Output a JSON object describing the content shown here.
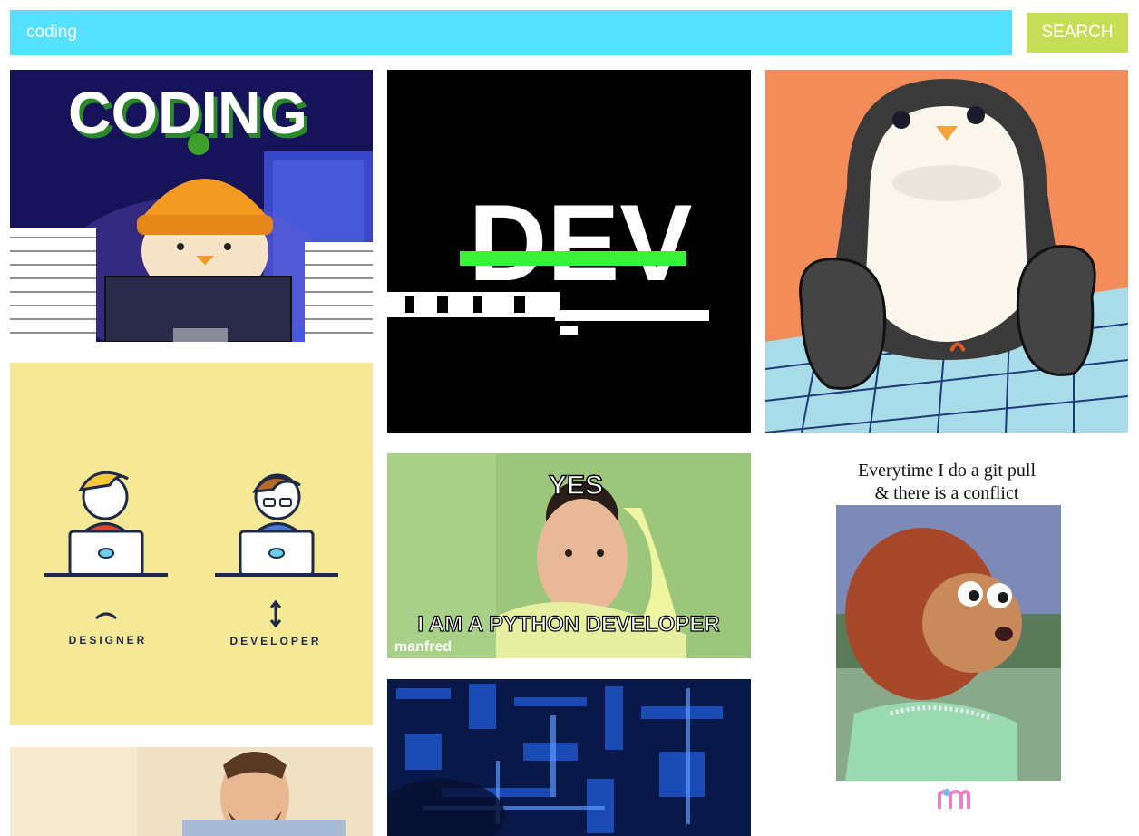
{
  "search": {
    "value": "coding",
    "button_label": "SEARCH"
  },
  "colors": {
    "search_bg": "#54e0ff",
    "button_bg": "#c6dd58"
  },
  "gifs": [
    {
      "name": "coding-penguin-gif",
      "text": "CODING"
    },
    {
      "name": "dev-glitch-gif",
      "text": "DEV"
    },
    {
      "name": "penguin-crossword-gif",
      "text": ""
    },
    {
      "name": "designer-developer-gif",
      "labels": [
        "DESIGNER",
        "DEVELOPER"
      ]
    },
    {
      "name": "python-developer-meme-gif",
      "top_text": "YES",
      "bottom_text": "I AM A PYTHON DEVELOPER",
      "watermark": "manfred"
    },
    {
      "name": "git-pull-monkey-gif",
      "caption_line1": "Everytime I do a git pull",
      "caption_line2": "& there is a conflict"
    },
    {
      "name": "excited-man-laptop-gif"
    },
    {
      "name": "blue-circuit-gif"
    }
  ]
}
